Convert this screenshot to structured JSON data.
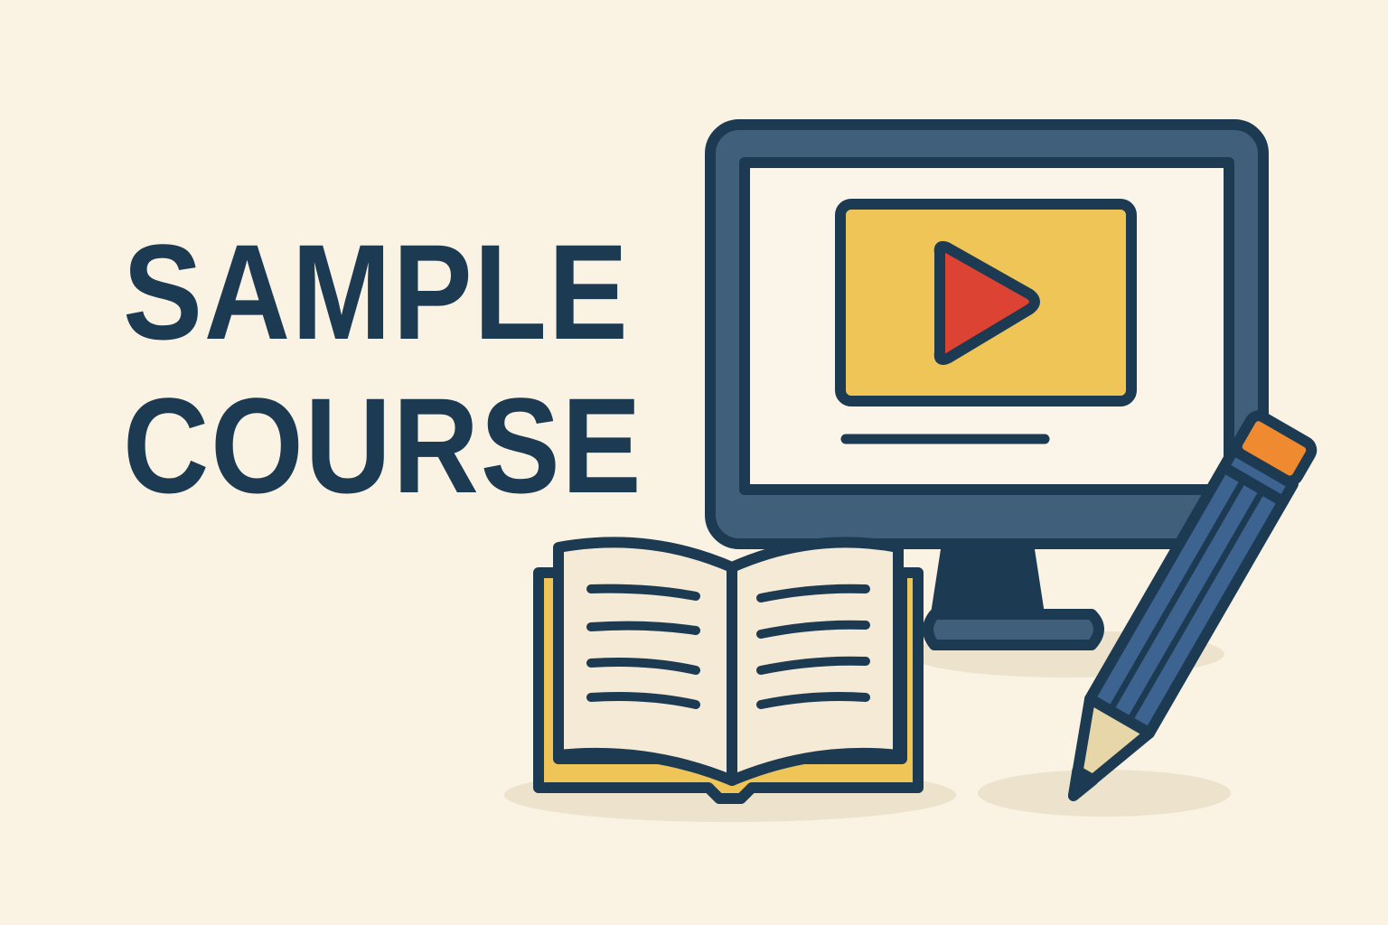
{
  "title": {
    "line1": "SAMPLE",
    "line2": "COURSE"
  },
  "icons": [
    "monitor-icon",
    "video-player-icon",
    "play-icon",
    "open-book-icon",
    "pencil-icon"
  ],
  "colors": {
    "background": "#faf2e2",
    "title_text": "#1c3a52",
    "outline": "#1c3a52",
    "monitor_frame": "#3f5f7a",
    "screen": "#fbf5e9",
    "video_panel": "#f0c557",
    "play_button": "#dc4332",
    "book_cover": "#f0c557",
    "book_pages": "#f5ead6",
    "pencil_body": "#3d6390",
    "pencil_eraser": "#ef8a30",
    "pencil_wood": "#e6d6a8",
    "shadow": "#ede2cb"
  }
}
